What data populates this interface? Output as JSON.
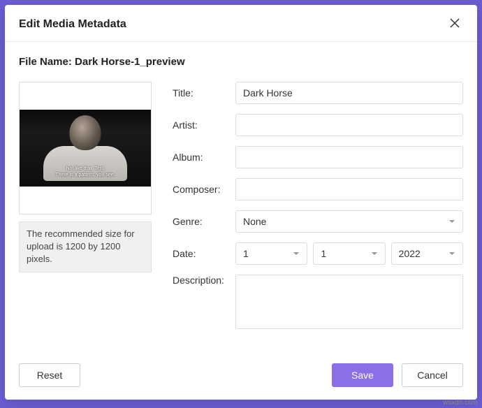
{
  "modal": {
    "title": "Edit Media Metadata",
    "file_name_prefix": "File Name: ",
    "file_name": "Dark Horse-1_preview"
  },
  "preview": {
    "subtitle_line1": "Not like that, Tejs!",
    "subtitle_line2": "There is a pattern, you see.",
    "hint": "The recommended size for upload is 1200 by 1200 pixels."
  },
  "form": {
    "title_label": "Title:",
    "title_value": "Dark Horse",
    "artist_label": "Artist:",
    "artist_value": "",
    "album_label": "Album:",
    "album_value": "",
    "composer_label": "Composer:",
    "composer_value": "",
    "genre_label": "Genre:",
    "genre_value": "None",
    "date_label": "Date:",
    "date_day": "1",
    "date_month": "1",
    "date_year": "2022",
    "description_label": "Description:",
    "description_value": ""
  },
  "footer": {
    "reset": "Reset",
    "save": "Save",
    "cancel": "Cancel"
  },
  "watermark": "wsxdn.com"
}
